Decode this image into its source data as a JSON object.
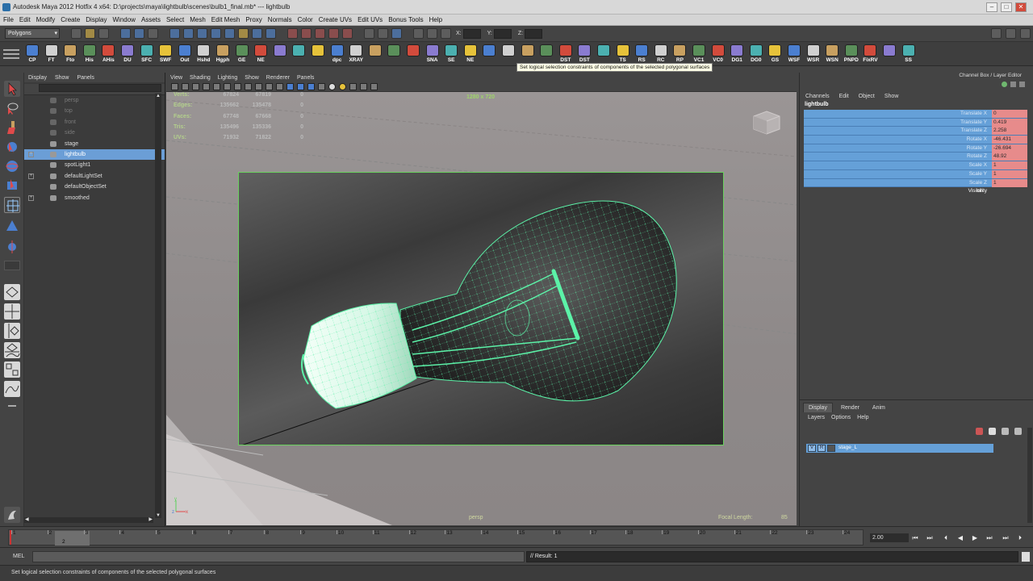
{
  "window": {
    "title": "Autodesk Maya 2012 Hotfix 4 x64: D:\\projects\\maya\\lightbulb\\scenes\\bulb1_final.mb*   ---   lightbulb",
    "controls": [
      "–",
      "□",
      "✕"
    ]
  },
  "menubar": [
    "File",
    "Edit",
    "Modify",
    "Create",
    "Display",
    "Window",
    "Assets",
    "Select",
    "Mesh",
    "Edit Mesh",
    "Proxy",
    "Normals",
    "Color",
    "Create UVs",
    "Edit UVs",
    "Bonus Tools",
    "Help"
  ],
  "statusline": {
    "mode": "Polygons",
    "x_label": "X:",
    "y_label": "Y:",
    "z_label": "Z:"
  },
  "shelf": {
    "buttons": [
      "CP",
      "FT",
      "Fto",
      "His",
      "AHis",
      "DU",
      "SFC",
      "SWF",
      "Out",
      "Hshd",
      "Hgph",
      "GE",
      "NE",
      "",
      "",
      "",
      "dpc",
      "XRAY",
      "",
      "",
      "",
      "SNA",
      "SE",
      "NE",
      "",
      "",
      "",
      "",
      "DST",
      "DST",
      "",
      "TS",
      "RS",
      "RC",
      "RP",
      "VC1",
      "VC0",
      "DG1",
      "DG0",
      "GS",
      "WSF",
      "WSR",
      "WSN",
      "PNPD",
      "FixRV",
      "",
      "SS"
    ],
    "tooltip": "Set logical selection constraints of components of the selected polygonal surfaces"
  },
  "outliner": {
    "menu": [
      "Display",
      "Show",
      "Panels"
    ],
    "items": [
      {
        "label": "persp",
        "state": "dim",
        "expand": ""
      },
      {
        "label": "top",
        "state": "dim",
        "expand": ""
      },
      {
        "label": "front",
        "state": "dim",
        "expand": ""
      },
      {
        "label": "side",
        "state": "dim",
        "expand": ""
      },
      {
        "label": "stage",
        "state": "",
        "expand": ""
      },
      {
        "label": "lightbulb",
        "state": "sel",
        "expand": "+"
      },
      {
        "label": "spotLight1",
        "state": "",
        "expand": ""
      },
      {
        "label": "defaultLightSet",
        "state": "",
        "expand": "+"
      },
      {
        "label": "defaultObjectSet",
        "state": "",
        "expand": ""
      },
      {
        "label": "smoothed",
        "state": "",
        "expand": "+"
      }
    ]
  },
  "viewport": {
    "menu": [
      "View",
      "Shading",
      "Lighting",
      "Show",
      "Renderer",
      "Panels"
    ],
    "resolution": "1280 x 720",
    "camera": "persp",
    "focal_label": "Focal Length:",
    "focal_value": "85",
    "hud": [
      {
        "label": "Verts:",
        "v1": "67824",
        "v2": "67819",
        "v3": "0"
      },
      {
        "label": "Edges:",
        "v1": "135662",
        "v2": "135478",
        "v3": "0"
      },
      {
        "label": "Faces:",
        "v1": "67748",
        "v2": "67668",
        "v3": "0"
      },
      {
        "label": "Tris:",
        "v1": "135496",
        "v2": "135336",
        "v3": "0"
      },
      {
        "label": "UVs:",
        "v1": "71932",
        "v2": "71822",
        "v3": "0"
      }
    ]
  },
  "channelbox": {
    "header": "Channel Box / Layer Editor",
    "menu": [
      "Channels",
      "Edit",
      "Object",
      "Show"
    ],
    "object": "lightbulb",
    "channels": [
      {
        "name": "Translate X",
        "value": "0"
      },
      {
        "name": "Translate Y",
        "value": "0.419"
      },
      {
        "name": "Translate Z",
        "value": "2.258"
      },
      {
        "name": "Rotate X",
        "value": "-46.431"
      },
      {
        "name": "Rotate Y",
        "value": "-26.694"
      },
      {
        "name": "Rotate Z",
        "value": "48.92"
      },
      {
        "name": "Scale X",
        "value": "1"
      },
      {
        "name": "Scale Y",
        "value": "1"
      },
      {
        "name": "Scale Z",
        "value": "1"
      }
    ],
    "visibility": {
      "name": "Visibility",
      "value": "on"
    }
  },
  "layer_editor": {
    "tabs": [
      "Display",
      "Render",
      "Anim"
    ],
    "menu": [
      "Layers",
      "Options",
      "Help"
    ],
    "layer": {
      "v": "V",
      "r": "R",
      "name": "stage_L"
    }
  },
  "timeline": {
    "ticks": [
      "1",
      "2",
      "3",
      "4",
      "5",
      "6",
      "7",
      "8",
      "9",
      "10",
      "11",
      "12",
      "13",
      "14",
      "15",
      "16",
      "17",
      "18",
      "19",
      "20",
      "21",
      "22",
      "23",
      "24"
    ],
    "current": "2",
    "frame_field": "2.00",
    "controls": [
      "⏮",
      "⏭",
      "◀",
      "◀",
      "▶",
      "⏭",
      "⏭",
      "⚙"
    ]
  },
  "command": {
    "mel": "MEL",
    "result": "// Result: 1"
  },
  "helpline": "Set logical selection constraints of components of the selected polygonal surfaces",
  "colors": {
    "selection": "#65a0d8",
    "channel_value": "#e78b8b",
    "wire": "#5cf2a8",
    "gate": "#6ad15e"
  }
}
